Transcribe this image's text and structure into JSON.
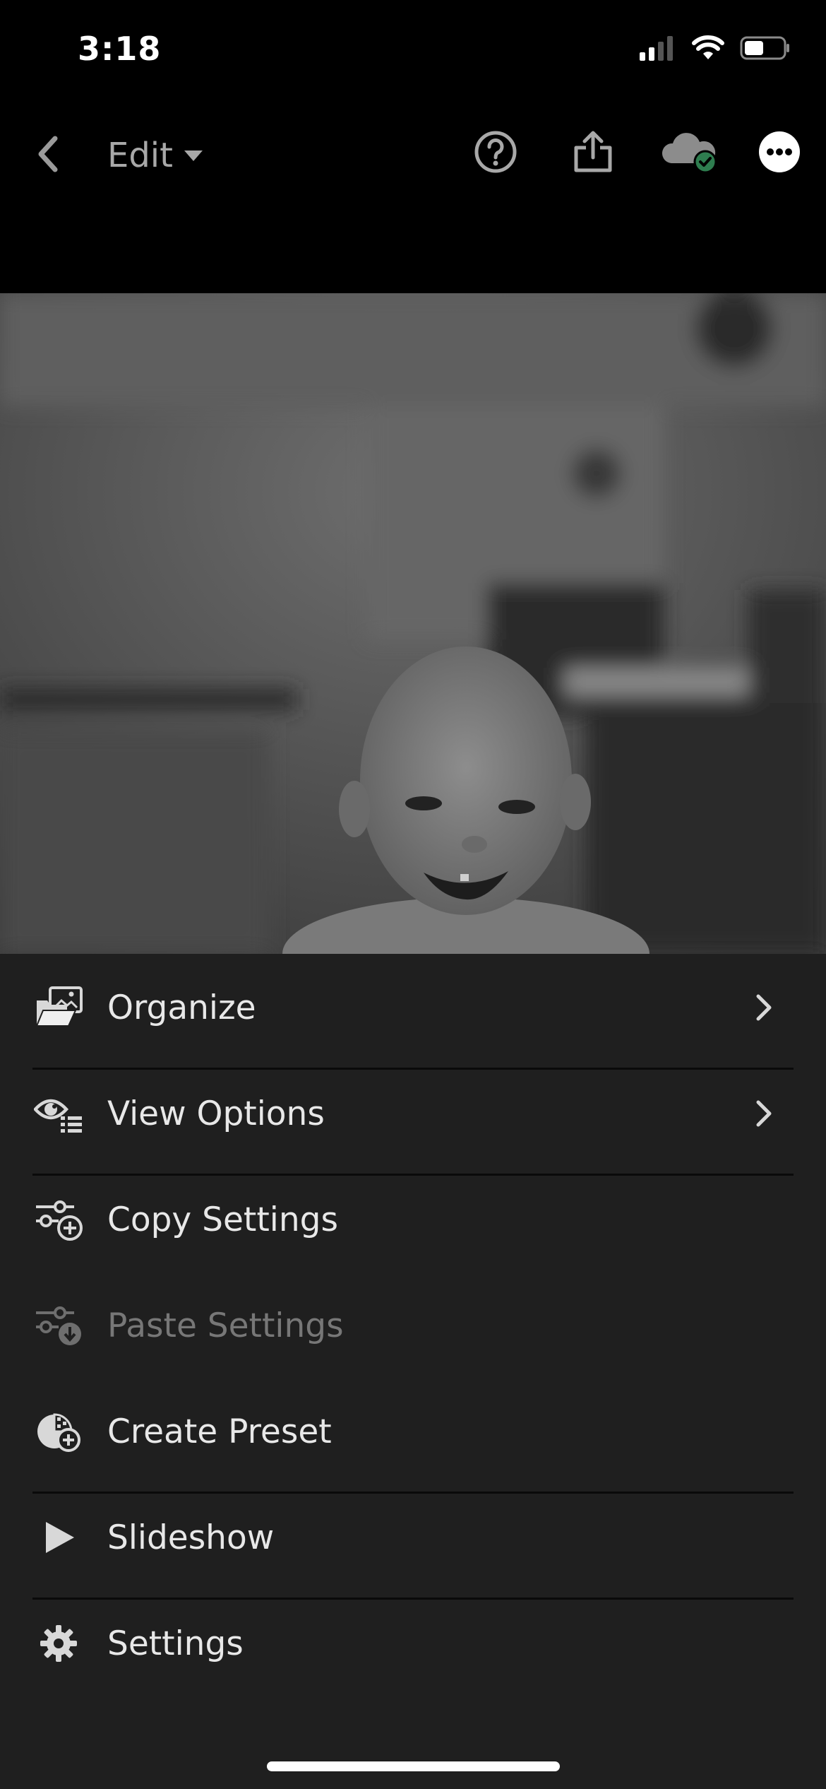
{
  "status_bar": {
    "time": "3:18"
  },
  "toolbar": {
    "edit_label": "Edit",
    "icons": {
      "back": "chevron-left-icon",
      "help": "help-circle-icon",
      "share": "share-icon",
      "cloud": "cloud-synced-icon",
      "more": "more-icon"
    },
    "cloud_check_color": "#2e7d4f"
  },
  "menu": {
    "items": [
      {
        "label": "Organize",
        "icon": "folder-images-icon",
        "has_chevron": true,
        "enabled": true
      },
      {
        "label": "View Options",
        "icon": "eye-list-icon",
        "has_chevron": true,
        "enabled": true
      },
      {
        "label": "Copy Settings",
        "icon": "sliders-plus-icon",
        "has_chevron": false,
        "enabled": true
      },
      {
        "label": "Paste Settings",
        "icon": "sliders-download-icon",
        "has_chevron": false,
        "enabled": false
      },
      {
        "label": "Create Preset",
        "icon": "preset-plus-icon",
        "has_chevron": false,
        "enabled": true
      },
      {
        "label": "Slideshow",
        "icon": "play-icon",
        "has_chevron": false,
        "enabled": true
      },
      {
        "label": "Settings",
        "icon": "gear-icon",
        "has_chevron": false,
        "enabled": true
      }
    ]
  },
  "colors": {
    "sheet_background": "#1f1f1f",
    "toolbar_background": "#000000",
    "disabled_text": "#777777"
  }
}
